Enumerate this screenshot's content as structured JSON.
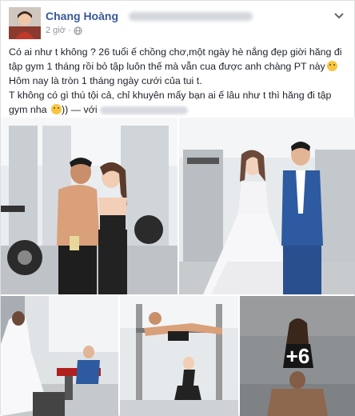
{
  "post": {
    "author_name": "Chang Hoàng",
    "time_ago": "2 giờ",
    "privacy_icon": "globe-icon",
    "paragraph_1": "Có ai như t không ? 26 tuổi ế chồng chơ,một ngày hè nắng đẹp giời hăng đi tập gym 1 tháng rồi bỏ tập luôn thế mà vẫn cua được anh chàng PT này",
    "paragraph_2": "Hôm nay là tròn 1 tháng ngày cưới của tui t.",
    "paragraph_3": "T không có gì thú tội cả, chỉ khuyên mấy bạn ai ế lâu như t thì hăng đi tập gym nha",
    "paragraph_3_suffix": ")) — với",
    "more_photos": "+6"
  },
  "colors": {
    "author": "#385898",
    "meta": "#90949c",
    "text": "#1d2129",
    "border": "#dddfe2"
  },
  "photos": [
    {
      "name": "couple-shirtless-gym"
    },
    {
      "name": "wedding-dress-suit-gym"
    },
    {
      "name": "bride-and-bench"
    },
    {
      "name": "workout-couple"
    },
    {
      "name": "pushup-couple"
    }
  ]
}
